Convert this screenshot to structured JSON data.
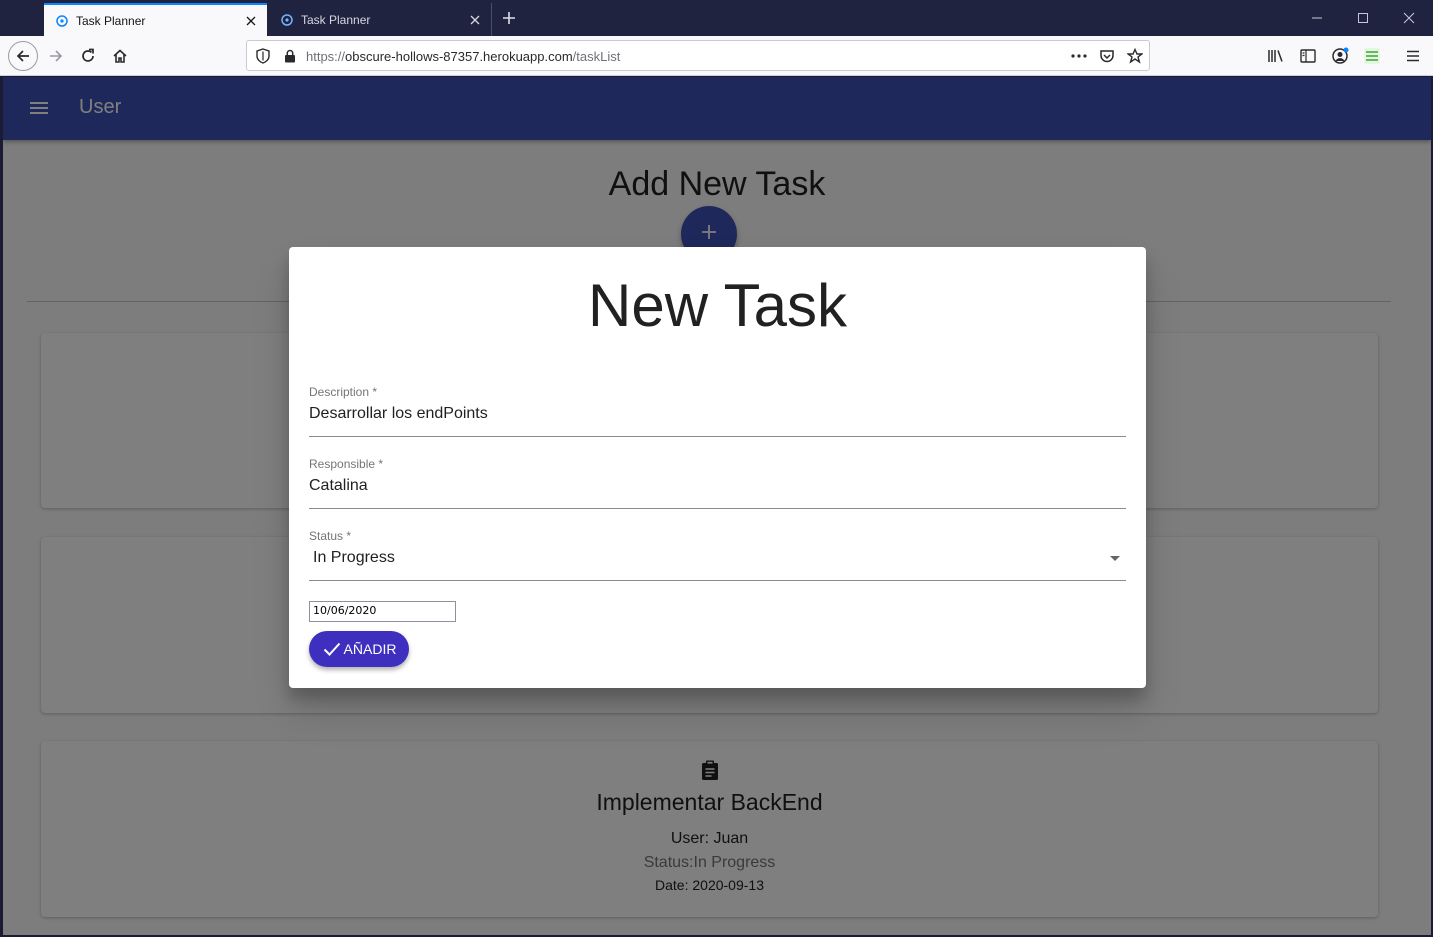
{
  "browser": {
    "tabs": [
      {
        "title": "Task Planner",
        "active": true
      },
      {
        "title": "Task Planner",
        "active": false
      }
    ],
    "url": {
      "prefix": "https://",
      "domain": "obscure-hollows-87357.herokuapp.com",
      "path": "/taskList"
    }
  },
  "app": {
    "appbar_title": "User",
    "heading": "Add New Task",
    "fab_icon": "add-icon",
    "task_card": {
      "title": "Implementar BackEnd",
      "user": "User: Juan",
      "status": "Status:In Progress",
      "date": "Date: 2020-09-13"
    }
  },
  "modal": {
    "title": "New Task",
    "description_label": "Description *",
    "description_value": "Desarrollar los endPoints",
    "responsible_label": "Responsible *",
    "responsible_value": "Catalina",
    "status_label": "Status *",
    "status_value": "In Progress",
    "date_value": "10/06/2020",
    "submit_label": "AÑADIR"
  },
  "colors": {
    "primary": "#3f51b5",
    "submit": "#3f2fbf",
    "tab_accent": "#0a84ff"
  }
}
